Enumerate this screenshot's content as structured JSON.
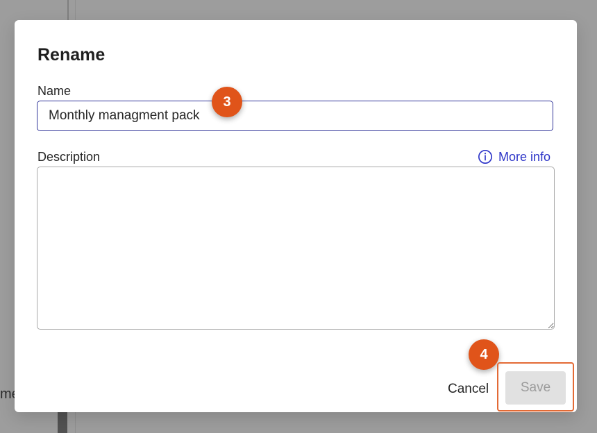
{
  "background": {
    "partial_text": "me"
  },
  "dialog": {
    "title": "Rename",
    "name_label": "Name",
    "name_value": "Monthly managment pack",
    "description_label": "Description",
    "more_info_label": "More info",
    "description_value": "",
    "cancel_label": "Cancel",
    "save_label": "Save"
  },
  "callouts": {
    "step_name": "3",
    "step_save": "4"
  },
  "colors": {
    "accent": "#2d35c8",
    "step_badge": "#e0541a",
    "disabled_button": "#e1e1e1"
  },
  "icons": {
    "info": "info-circle-icon",
    "resize": "resize-handle-icon"
  }
}
